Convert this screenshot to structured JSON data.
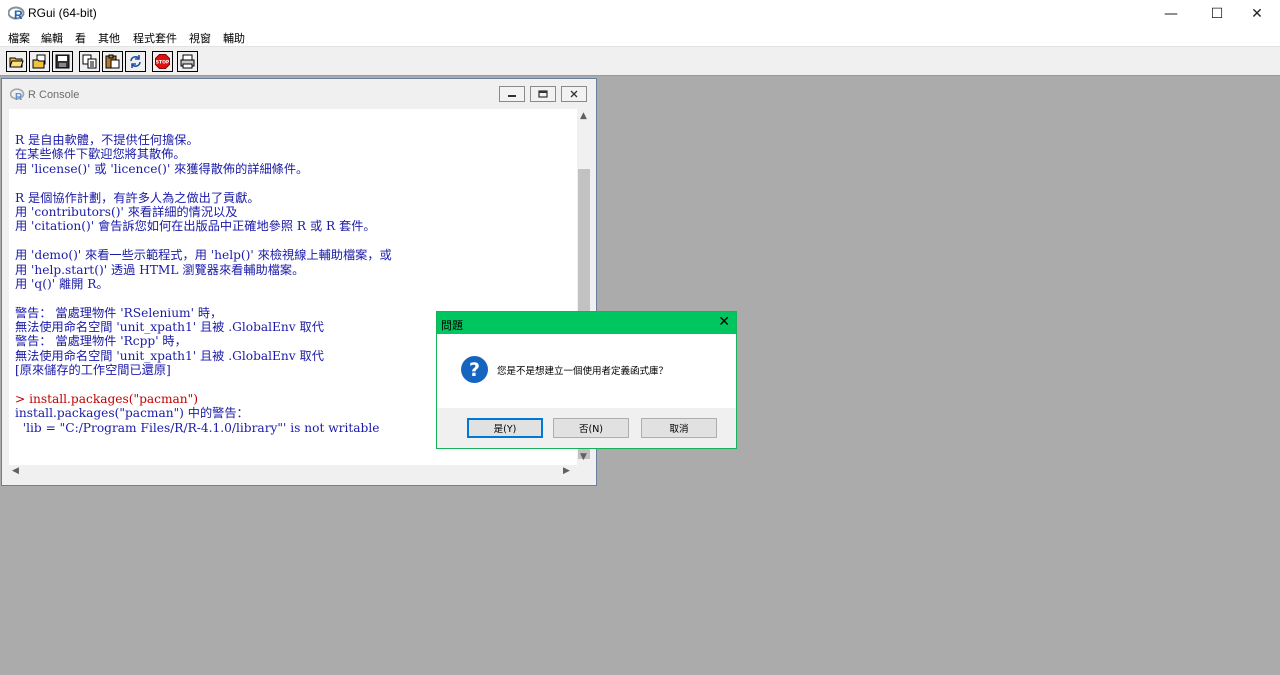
{
  "app": {
    "title": "RGui (64-bit)",
    "window_buttons": {
      "minimize": "—",
      "maximize": "☐",
      "close": "✕"
    }
  },
  "menu": [
    "檔案",
    "編輯",
    "看",
    "其他",
    "程式套件",
    "視窗",
    "輔助"
  ],
  "toolbar": [
    "open-script-icon",
    "load-workspace-icon",
    "save-icon",
    "copy-icon",
    "paste-icon",
    "refresh-icon",
    "stop-icon",
    "print-icon"
  ],
  "console": {
    "title": "R Console",
    "lines": [
      {
        "text": "R 是自由軟體，不提供任何擔保。",
        "color": "blue"
      },
      {
        "text": "在某些條件下歡迎您將其散佈。",
        "color": "blue"
      },
      {
        "text": "用 'license()' 或 'licence()' 來獲得散佈的詳細條件。",
        "color": "blue"
      },
      {
        "text": "",
        "color": "blue"
      },
      {
        "text": "R 是個協作計劃，有許多人為之做出了貢獻。",
        "color": "blue"
      },
      {
        "text": "用 'contributors()' 來看詳細的情況以及",
        "color": "blue"
      },
      {
        "text": "用 'citation()' 會告訴您如何在出版品中正確地參照 R 或 R 套件。",
        "color": "blue"
      },
      {
        "text": "",
        "color": "blue"
      },
      {
        "text": "用 'demo()' 來看一些示範程式，用 'help()' 來檢視線上輔助檔案，或",
        "color": "blue"
      },
      {
        "text": "用 'help.start()' 透過 HTML 瀏覽器來看輔助檔案。",
        "color": "blue"
      },
      {
        "text": "用 'q()' 離開 R。",
        "color": "blue"
      },
      {
        "text": "",
        "color": "blue"
      },
      {
        "text": "警告： 當處理物件 'RSelenium' 時，",
        "color": "blue"
      },
      {
        "text": "無法使用命名空間 'unit_xpath1' 且被 .GlobalEnv 取代",
        "color": "blue"
      },
      {
        "text": "警告： 當處理物件 'Rcpp' 時，",
        "color": "blue"
      },
      {
        "text": "無法使用命名空間 'unit_xpath1' 且被 .GlobalEnv 取代",
        "color": "blue"
      },
      {
        "text": "[原來儲存的工作空間已還原]",
        "color": "blue"
      },
      {
        "text": "",
        "color": "blue"
      },
      {
        "text": "> install.packages(\"pacman\")",
        "color": "red"
      },
      {
        "text": "install.packages(\"pacman\") 中的警告：",
        "color": "blue"
      },
      {
        "text": "  'lib = \"C:/Program Files/R/R-4.1.0/library\"' is not writable",
        "color": "blue"
      }
    ]
  },
  "dialog": {
    "title": "問題",
    "message": "您是不是想建立一個使用者定義函式庫？",
    "buttons": {
      "yes": "是(Y)",
      "no": "否(N)",
      "cancel": "取消"
    }
  }
}
